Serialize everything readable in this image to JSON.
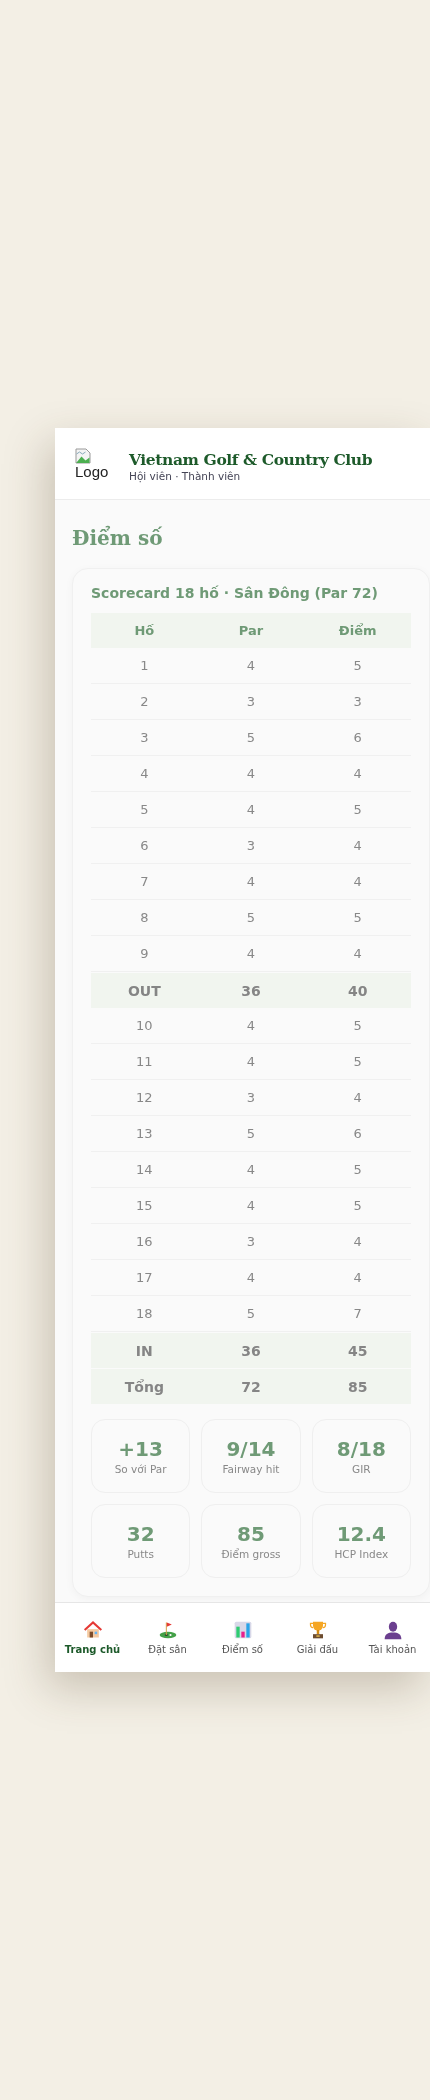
{
  "header": {
    "logo_alt": "Logo",
    "title": "Vietnam Golf & Country Club",
    "subtitle": "Hội viên · Thành viên"
  },
  "page_title": "Điểm số",
  "scorecard": {
    "title": "Scorecard 18 hố · Sân Đông (Par 72)",
    "columns": [
      "Hố",
      "Par",
      "Điểm"
    ],
    "rows": [
      {
        "kind": "hole",
        "cells": [
          "1",
          "4",
          "5"
        ]
      },
      {
        "kind": "hole",
        "cells": [
          "2",
          "3",
          "3"
        ]
      },
      {
        "kind": "hole",
        "cells": [
          "3",
          "5",
          "6"
        ]
      },
      {
        "kind": "hole",
        "cells": [
          "4",
          "4",
          "4"
        ]
      },
      {
        "kind": "hole",
        "cells": [
          "5",
          "4",
          "5"
        ]
      },
      {
        "kind": "hole",
        "cells": [
          "6",
          "3",
          "4"
        ]
      },
      {
        "kind": "hole",
        "cells": [
          "7",
          "4",
          "4"
        ]
      },
      {
        "kind": "hole",
        "cells": [
          "8",
          "5",
          "5"
        ]
      },
      {
        "kind": "hole",
        "cells": [
          "9",
          "4",
          "4"
        ]
      },
      {
        "kind": "subtotal",
        "cells": [
          "OUT",
          "36",
          "40"
        ]
      },
      {
        "kind": "hole",
        "cells": [
          "10",
          "4",
          "5"
        ]
      },
      {
        "kind": "hole",
        "cells": [
          "11",
          "4",
          "5"
        ]
      },
      {
        "kind": "hole",
        "cells": [
          "12",
          "3",
          "4"
        ]
      },
      {
        "kind": "hole",
        "cells": [
          "13",
          "5",
          "6"
        ]
      },
      {
        "kind": "hole",
        "cells": [
          "14",
          "4",
          "5"
        ]
      },
      {
        "kind": "hole",
        "cells": [
          "15",
          "4",
          "5"
        ]
      },
      {
        "kind": "hole",
        "cells": [
          "16",
          "3",
          "4"
        ]
      },
      {
        "kind": "hole",
        "cells": [
          "17",
          "4",
          "4"
        ]
      },
      {
        "kind": "hole",
        "cells": [
          "18",
          "5",
          "7"
        ]
      },
      {
        "kind": "subtotal",
        "cells": [
          "IN",
          "36",
          "45"
        ]
      },
      {
        "kind": "subtotal",
        "cells": [
          "Tổng",
          "72",
          "85"
        ]
      }
    ],
    "stats": [
      {
        "value": "+13",
        "label": "So với Par"
      },
      {
        "value": "9/14",
        "label": "Fairway hit"
      },
      {
        "value": "8/18",
        "label": "GIR"
      },
      {
        "value": "32",
        "label": "Putts"
      },
      {
        "value": "85",
        "label": "Điểm gross"
      },
      {
        "value": "12.4",
        "label": "HCP Index"
      }
    ]
  },
  "nav": [
    {
      "kind": "house",
      "label": "Trang chủ",
      "selected": true
    },
    {
      "kind": "golf",
      "label": "Đặt sân",
      "selected": false
    },
    {
      "kind": "chart",
      "label": "Điểm số",
      "selected": false
    },
    {
      "kind": "trophy",
      "label": "Giải đấu",
      "selected": false
    },
    {
      "kind": "person",
      "label": "Tài khoản",
      "selected": false
    }
  ]
}
